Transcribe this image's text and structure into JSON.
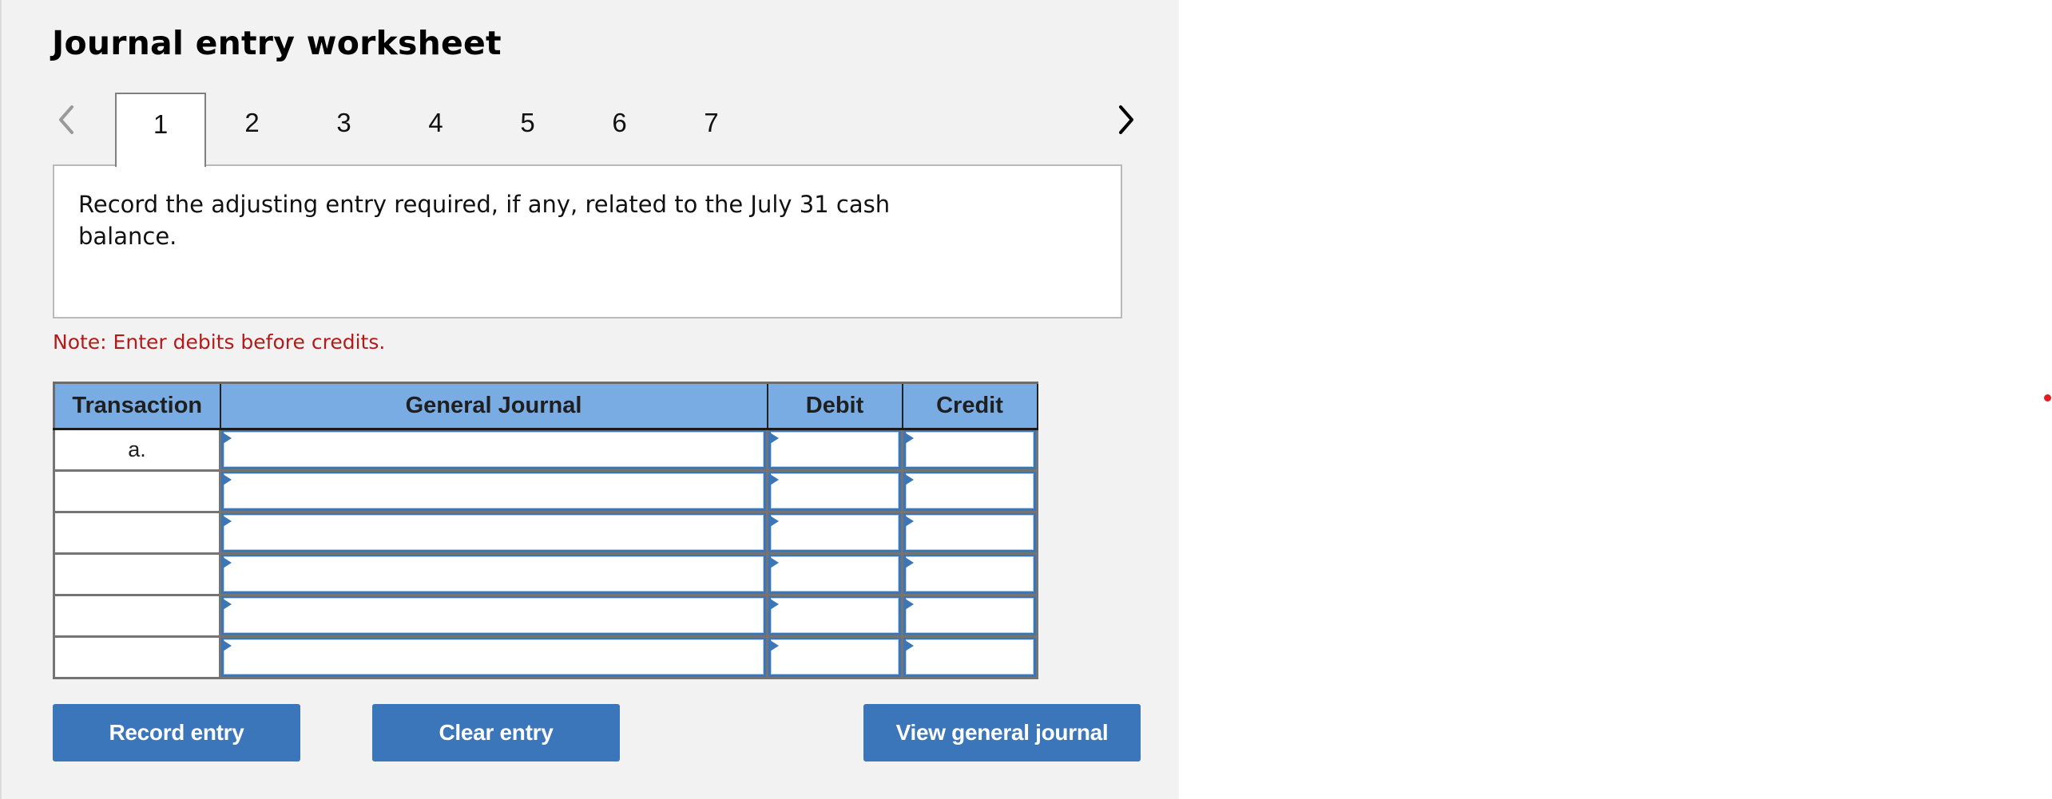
{
  "worksheet": {
    "title": "Journal entry worksheet",
    "nav": {
      "prev_icon": "chevron-left-icon",
      "next_icon": "chevron-right-icon",
      "prev_enabled": false,
      "next_enabled": true
    },
    "tabs": [
      {
        "label": "1",
        "active": true
      },
      {
        "label": "2",
        "active": false
      },
      {
        "label": "3",
        "active": false
      },
      {
        "label": "4",
        "active": false
      },
      {
        "label": "5",
        "active": false
      },
      {
        "label": "6",
        "active": false
      },
      {
        "label": "7",
        "active": false
      }
    ],
    "question": "Record the adjusting entry required, if any, related to the July 31 cash balance.",
    "note": "Note: Enter debits before credits."
  },
  "journal": {
    "columns": [
      "Transaction",
      "General Journal",
      "Debit",
      "Credit"
    ],
    "rows": [
      {
        "transaction": "a.",
        "account": "",
        "debit": "",
        "credit": ""
      },
      {
        "transaction": "",
        "account": "",
        "debit": "",
        "credit": ""
      },
      {
        "transaction": "",
        "account": "",
        "debit": "",
        "credit": ""
      },
      {
        "transaction": "",
        "account": "",
        "debit": "",
        "credit": ""
      },
      {
        "transaction": "",
        "account": "",
        "debit": "",
        "credit": ""
      },
      {
        "transaction": "",
        "account": "",
        "debit": "",
        "credit": ""
      }
    ]
  },
  "buttons": {
    "record": "Record entry",
    "clear": "Clear entry",
    "view": "View general journal"
  },
  "colors": {
    "panel_bg": "#f2f2f2",
    "header_bg": "#79ace3",
    "button_bg": "#3a76b9",
    "input_border": "#3b76b9",
    "note_text": "#b31b1b",
    "indicator_dot": "#e8191f"
  }
}
